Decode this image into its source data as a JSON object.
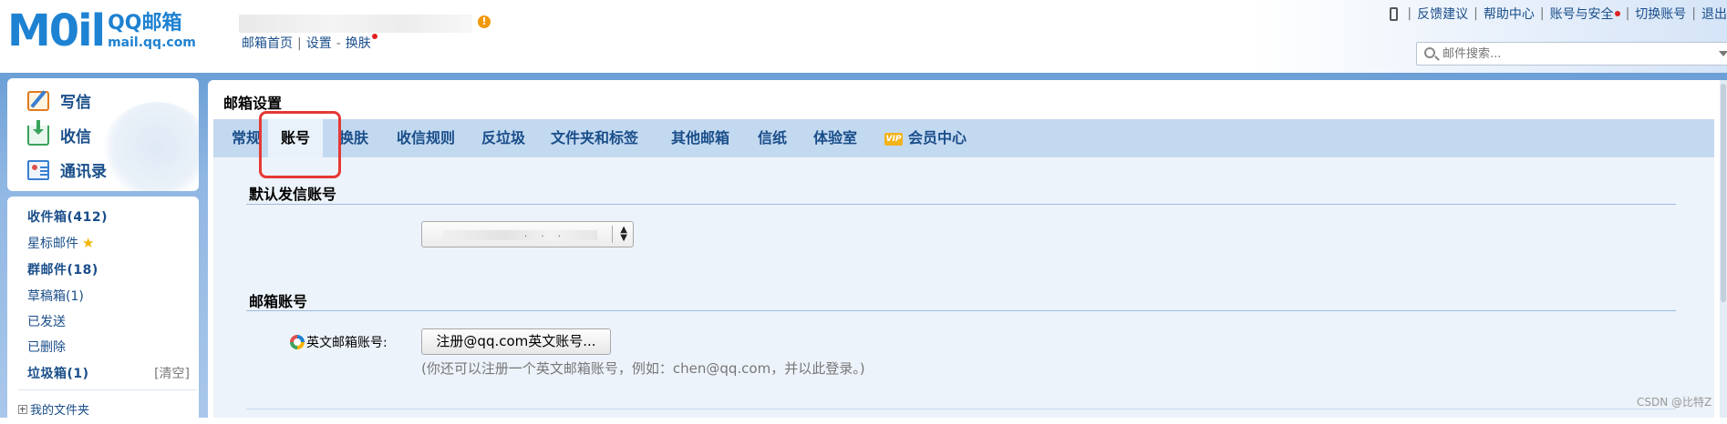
{
  "header": {
    "logo_mark": "M0il",
    "logo_cn": "QQ邮箱",
    "logo_url": "mail.qq.com",
    "user_links": [
      "邮箱首页",
      "设置",
      "换肤"
    ],
    "top_links": [
      "反馈建议",
      "帮助中心",
      "账号与安全",
      "切换账号",
      "退出"
    ],
    "search_placeholder": "邮件搜索...",
    "icons": [
      "phone-icon",
      "search-icon",
      "warning-icon"
    ]
  },
  "quick_actions": [
    "写信",
    "收信",
    "通讯录"
  ],
  "folders": {
    "inbox": "收件箱(412)",
    "starred": "星标邮件",
    "group": "群邮件(18)",
    "drafts": "草稿箱(1)",
    "sent": "已发送",
    "deleted": "已删除",
    "spam": "垃圾箱(1)",
    "clear": "[清空]",
    "my_folders": "我的文件夹"
  },
  "settings": {
    "title": "邮箱设置",
    "tabs": [
      "常规",
      "账号",
      "换肤",
      "收信规则",
      "反垃圾",
      "文件夹和标签",
      "其他邮箱",
      "信纸",
      "体验室",
      "会员中心"
    ],
    "active_tab": "账号",
    "vip_badge": "VIP"
  },
  "account": {
    "default_sender_title": "默认发信账号",
    "default_sender_value": ". . .",
    "mailbox_title": "邮箱账号",
    "english_label": "英文邮箱账号:",
    "register_button": "注册@qq.com英文账号...",
    "hint": "(你还可以注册一个英文邮箱账号，例如：chen@qq.com，并以此登录。)"
  },
  "watermark": "CSDN @比特Z",
  "colors": {
    "brand": "#1e82d2",
    "link": "#1a4e8a",
    "tab_bar": "#c3d9f0",
    "content_bg": "#edf3fa",
    "highlight": "#e53935"
  }
}
